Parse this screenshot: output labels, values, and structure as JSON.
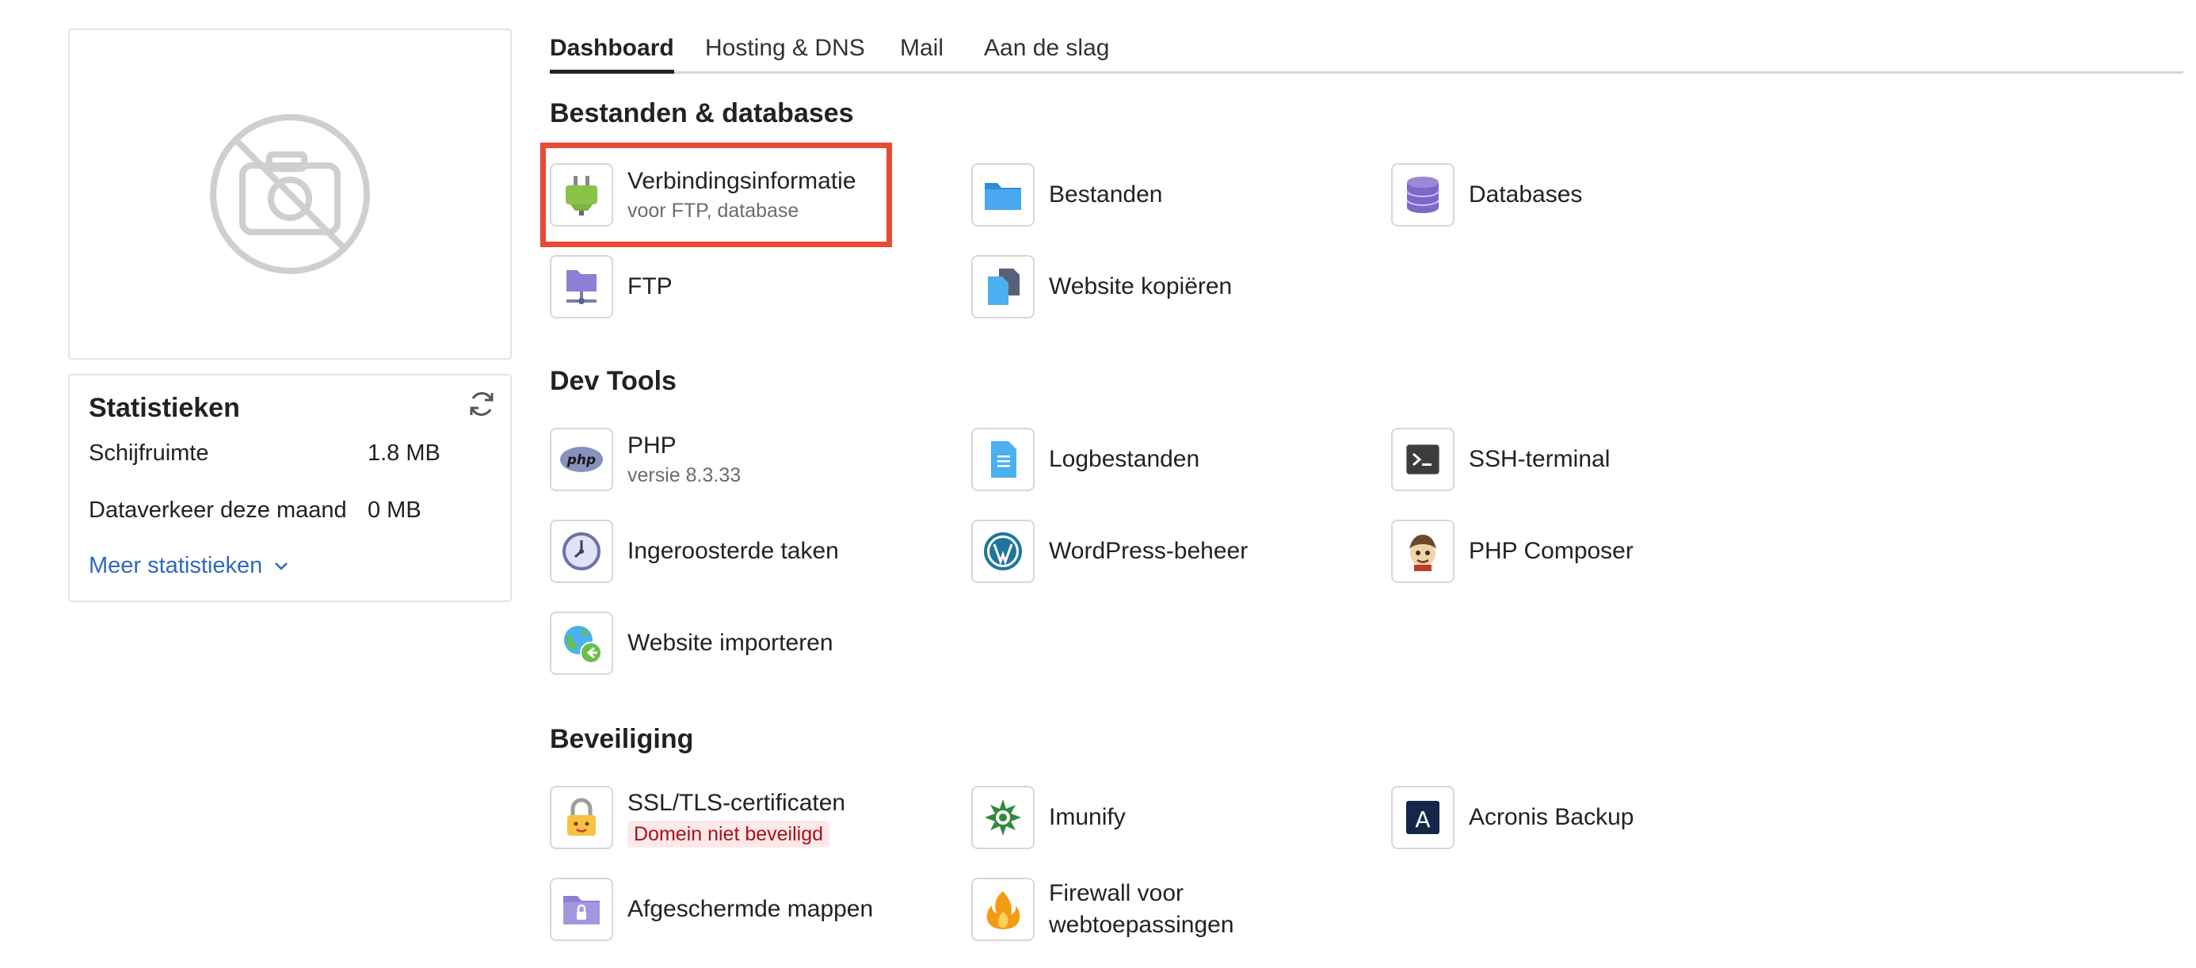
{
  "tabs": [
    {
      "label": "Dashboard",
      "active": true
    },
    {
      "label": "Hosting & DNS",
      "active": false
    },
    {
      "label": "Mail",
      "active": false
    },
    {
      "label": "Aan de slag",
      "active": false
    }
  ],
  "stats": {
    "title": "Statistieken",
    "rows": [
      {
        "label": "Schijfruimte",
        "value": "1.8 MB"
      },
      {
        "label": "Dataverkeer deze maand",
        "value": "0 MB"
      }
    ],
    "more_label": "Meer statistieken"
  },
  "sections": {
    "files": {
      "title": "Bestanden & databases",
      "items": [
        {
          "label": "Verbindingsinformatie",
          "sub": "voor FTP, database",
          "icon": "plug-icon"
        },
        {
          "label": "Bestanden",
          "icon": "folder-icon"
        },
        {
          "label": "Databases",
          "icon": "database-icon"
        },
        {
          "label": "FTP",
          "icon": "ftp-icon"
        },
        {
          "label": "Website kopiëren",
          "icon": "copy-files-icon"
        }
      ]
    },
    "dev": {
      "title": "Dev Tools",
      "items": [
        {
          "label": "PHP",
          "sub": "versie 8.3.33",
          "icon": "php-icon",
          "icon_text": "php"
        },
        {
          "label": "Logbestanden",
          "icon": "log-file-icon"
        },
        {
          "label": "SSH-terminal",
          "icon": "terminal-icon"
        },
        {
          "label": "Ingeroosterde taken",
          "icon": "clock-icon"
        },
        {
          "label": "WordPress-beheer",
          "icon": "wordpress-icon"
        },
        {
          "label": "PHP Composer",
          "icon": "composer-icon"
        },
        {
          "label": "Website importeren",
          "icon": "import-globe-icon"
        }
      ]
    },
    "security": {
      "title": "Beveiliging",
      "items": [
        {
          "label": "SSL/TLS-certificaten",
          "badge": "Domein niet beveiligd",
          "icon": "padlock-icon"
        },
        {
          "label": "Imunify",
          "icon": "imunify-icon"
        },
        {
          "label": "Acronis Backup",
          "icon": "acronis-icon",
          "icon_text": "A"
        },
        {
          "label": "Afgeschermde mappen",
          "icon": "protected-folder-icon"
        },
        {
          "label": "Firewall voor webtoepassingen",
          "icon": "firewall-icon"
        }
      ]
    }
  },
  "colors": {
    "link": "#2f69b8",
    "highlight": "#e84a33",
    "danger_text": "#a6121a",
    "danger_bg": "#fde9ea"
  }
}
